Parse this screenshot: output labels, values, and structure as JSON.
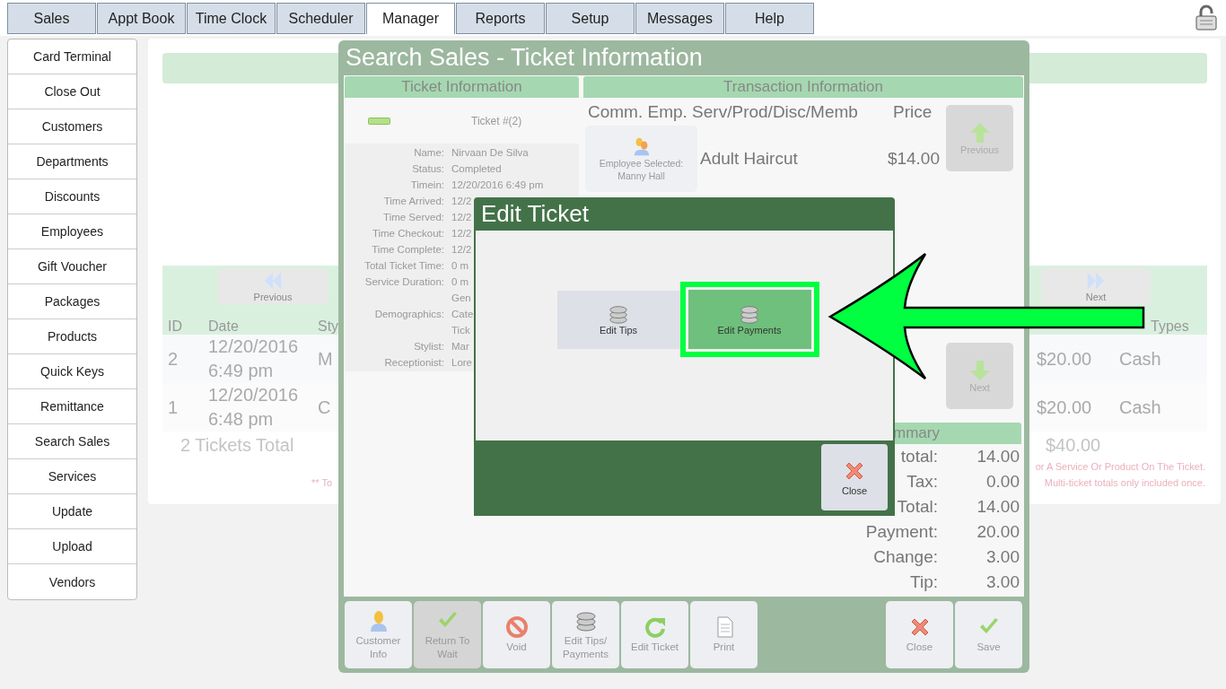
{
  "nav_tabs": [
    {
      "label": "Sales",
      "selected": false
    },
    {
      "label": "Appt Book",
      "selected": false
    },
    {
      "label": "Time Clock",
      "selected": false
    },
    {
      "label": "Scheduler",
      "selected": false
    },
    {
      "label": "Manager",
      "selected": true
    },
    {
      "label": "Reports",
      "selected": false
    },
    {
      "label": "Setup",
      "selected": false
    },
    {
      "label": "Messages",
      "selected": false
    },
    {
      "label": "Help",
      "selected": false
    }
  ],
  "sidebar": {
    "items": [
      "Card Terminal",
      "Close Out",
      "Customers",
      "Departments",
      "Discounts",
      "Employees",
      "Gift Voucher",
      "Packages",
      "Products",
      "Quick Keys",
      "Remittance",
      "Search Sales",
      "Services",
      "Update",
      "Upload",
      "Vendors"
    ]
  },
  "sales_list": {
    "previous": "Previous",
    "next": "Next",
    "column_headers": {
      "id": "ID",
      "date": "Date",
      "stylist": "Sty",
      "pay_types": "Types"
    },
    "rows": [
      {
        "id": "2",
        "date": "12/20/2016 6:49 pm",
        "stylist": "M",
        "payment": "$20.00",
        "pay_type": "Cash"
      },
      {
        "id": "1",
        "date": "12/20/2016 6:48 pm",
        "stylist": "C",
        "payment": "$20.00",
        "pay_type": "Cash"
      }
    ],
    "total_label": "2 Tickets Total",
    "total_payment": "$40.00",
    "note_left": "** To",
    "notes_right": [
      "or A Service Or Product On The Ticket.",
      "Multi-ticket totals only included once."
    ]
  },
  "search_sales_dialog": {
    "title": "Search Sales - Ticket Information",
    "ticket_info": {
      "header": "Ticket Information",
      "ticket_number": "Ticket #(2)",
      "fields": [
        {
          "label": "Name:",
          "values": [
            "Nirvaan De Silva"
          ]
        },
        {
          "label": "Status:",
          "values": [
            "Completed"
          ]
        },
        {
          "label": "Timein:",
          "values": [
            "12/20/2016 6:49 pm"
          ]
        },
        {
          "label": "Time Arrived:",
          "values": [
            "12/2"
          ]
        },
        {
          "label": "Time Served:",
          "values": [
            "12/2"
          ]
        },
        {
          "label": "Time Checkout:",
          "values": [
            "12/2"
          ]
        },
        {
          "label": "Time Complete:",
          "values": [
            "12/2"
          ]
        },
        {
          "label": "Total Ticket Time:",
          "values": [
            "0 m"
          ]
        },
        {
          "label": "Service Duration:",
          "values": [
            "0 m"
          ]
        },
        {
          "label": "Demographics:",
          "values": [
            "Gen",
            "Cate",
            "Tick"
          ]
        },
        {
          "label": "Stylist:",
          "values": [
            "Mar"
          ]
        },
        {
          "label": "Receptionist:",
          "values": [
            "Lore"
          ]
        }
      ]
    },
    "transaction": {
      "header": "Transaction Information",
      "columns_label": "Comm. Emp. Serv/Prod/Disc/Memb",
      "price_label": "Price",
      "items": [
        {
          "employee_label": "Employee Selected:",
          "employee": "Manny Hall",
          "name": "Adult Haircut",
          "price": "$14.00"
        }
      ],
      "previous": "Previous",
      "next": "Next"
    },
    "summary": {
      "header": "mmary",
      "rows": [
        {
          "label": "total:",
          "value": "14.00"
        },
        {
          "label": "Tax:",
          "value": "0.00"
        },
        {
          "label": "Total:",
          "value": "14.00"
        },
        {
          "label": "Payment:",
          "value": "20.00"
        },
        {
          "label": "Change:",
          "value": "3.00"
        },
        {
          "label": "Tip:",
          "value": "3.00"
        }
      ]
    },
    "toolbar": [
      {
        "label": "Customer Info",
        "disabled": false
      },
      {
        "label": "Return To Wait",
        "disabled": true
      },
      {
        "label": "Void",
        "disabled": false
      },
      {
        "label": "Edit Tips/ Payments",
        "disabled": false
      },
      {
        "label": "Edit Ticket",
        "disabled": false
      },
      {
        "label": "Print",
        "disabled": false
      }
    ],
    "toolbar_right": [
      {
        "label": "Close",
        "disabled": false
      },
      {
        "label": "Save",
        "disabled": false
      }
    ]
  },
  "edit_ticket_dialog": {
    "title": "Edit Ticket",
    "options": [
      {
        "label": "Edit Tips",
        "selected": false
      },
      {
        "label": "Edit Payments",
        "selected": true
      }
    ],
    "close": "Close"
  }
}
